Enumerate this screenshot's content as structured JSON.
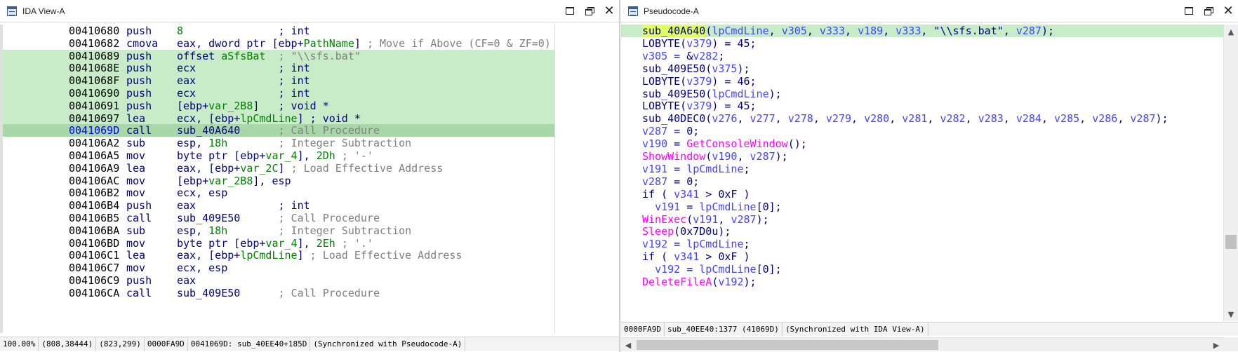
{
  "left_window": {
    "title": "IDA View-A",
    "buttons": {
      "maximize": "maximize",
      "restore": "restore",
      "close": "✕"
    },
    "lines": [
      {
        "addr": "00410680",
        "mnem": "push",
        "ops": "8",
        "cmt": "; int",
        "cmt_color": "navy"
      },
      {
        "addr": "00410682",
        "mnem": "cmova",
        "ops": "eax, dword ptr [ebp+PathName]",
        "cmt": "; Move if Above (CF=0 & ZF=0)"
      },
      {
        "addr": "00410689",
        "mnem": "push",
        "ops": "offset aSfsBat",
        "cmt": "; \"\\\\sfs.bat\""
      },
      {
        "addr": "0041068E",
        "mnem": "push",
        "ops": "ecx",
        "cmt": "; int",
        "cmt_color": "navy"
      },
      {
        "addr": "0041068F",
        "mnem": "push",
        "ops": "eax",
        "cmt": "; int",
        "cmt_color": "navy"
      },
      {
        "addr": "00410690",
        "mnem": "push",
        "ops": "ecx",
        "cmt": "; int",
        "cmt_color": "navy"
      },
      {
        "addr": "00410691",
        "mnem": "push",
        "ops": "[ebp+var_2B8]",
        "cmt": "; void *",
        "cmt_color": "navy"
      },
      {
        "addr": "00410697",
        "mnem": "lea",
        "ops": "ecx, [ebp+lpCmdLine]",
        "cmt": "; void *",
        "cmt_color": "navy"
      },
      {
        "addr": "0041069D",
        "mnem": "call",
        "ops": "sub_40A640",
        "cmt": "; Call Procedure"
      },
      {
        "addr": "004106A2",
        "mnem": "sub",
        "ops": "esp, 18h",
        "cmt": "; Integer Subtraction"
      },
      {
        "addr": "004106A5",
        "mnem": "mov",
        "ops": "byte ptr [ebp+var_4], 2Dh",
        "cmt": "; '-'"
      },
      {
        "addr": "004106A9",
        "mnem": "lea",
        "ops": "eax, [ebp+var_2C]",
        "cmt": "; Load Effective Address"
      },
      {
        "addr": "004106AC",
        "mnem": "mov",
        "ops": "[ebp+var_2B8], esp",
        "cmt": ""
      },
      {
        "addr": "004106B2",
        "mnem": "mov",
        "ops": "ecx, esp",
        "cmt": ""
      },
      {
        "addr": "004106B4",
        "mnem": "push",
        "ops": "eax",
        "cmt": "; int",
        "cmt_color": "navy"
      },
      {
        "addr": "004106B5",
        "mnem": "call",
        "ops": "sub_409E50",
        "cmt": "; Call Procedure"
      },
      {
        "addr": "004106BA",
        "mnem": "sub",
        "ops": "esp, 18h",
        "cmt": "; Integer Subtraction"
      },
      {
        "addr": "004106BD",
        "mnem": "mov",
        "ops": "byte ptr [ebp+var_4], 2Eh",
        "cmt": "; '.'"
      },
      {
        "addr": "004106C1",
        "mnem": "lea",
        "ops": "eax, [ebp+lpCmdLine]",
        "cmt": "; Load Effective Address"
      },
      {
        "addr": "004106C7",
        "mnem": "mov",
        "ops": "ecx, esp",
        "cmt": ""
      },
      {
        "addr": "004106C9",
        "mnem": "push",
        "ops": "eax",
        "cmt": ""
      },
      {
        "addr": "004106CA",
        "mnem": "call",
        "ops": "sub_409E50",
        "cmt": "; Call Procedure"
      }
    ],
    "status": {
      "zoom": "100.00%",
      "coords1": "(808,38444)",
      "coords2": "(823,299)",
      "offset": "0000FA9D",
      "location": "0041069D: sub_40EE40+185D",
      "sync": "(Synchronized with Pseudocode-A)"
    }
  },
  "right_window": {
    "title": "Pseudocode-A",
    "buttons": {
      "maximize": "maximize",
      "restore": "restore",
      "close": "✕"
    },
    "lines": [
      "sub_40A640(lpCmdLine, v305, v333, v189, v333, \"\\\\sfs.bat\", v287);",
      "LOBYTE(v379) = 45;",
      "v305 = &v282;",
      "sub_409E50(v375);",
      "LOBYTE(v379) = 46;",
      "sub_409E50(lpCmdLine);",
      "LOBYTE(v379) = 45;",
      "sub_40DEC0(v276, v277, v278, v279, v280, v281, v282, v283, v284, v285, v286, v287);",
      "v287 = 0;",
      "v190 = GetConsoleWindow();",
      "ShowWindow(v190, v287);",
      "v191 = lpCmdLine;",
      "v287 = 0;",
      "if ( v341 > 0xF )",
      "  v191 = lpCmdLine[0];",
      "WinExec(v191, v287);",
      "Sleep(0x7D0u);",
      "v192 = lpCmdLine;",
      "if ( v341 > 0xF )",
      "  v192 = lpCmdLine[0];",
      "DeleteFileA(v192);"
    ],
    "status": {
      "offset": "0000FA9D",
      "location": "sub_40EE40:1377 (41069D)",
      "sync": "(Synchronized with IDA View-A)"
    },
    "scroll": {
      "up": "▲",
      "down": "▼",
      "left": "◀",
      "right": "▶"
    }
  },
  "colors": {
    "selection": "#c8ecc8",
    "current_line": "#a8d8a8",
    "function_name": "#ff00ff",
    "variable": "#4444ff",
    "keyword": "#000080",
    "comment": "#808080",
    "cursor_highlight": "#e0ff60"
  }
}
